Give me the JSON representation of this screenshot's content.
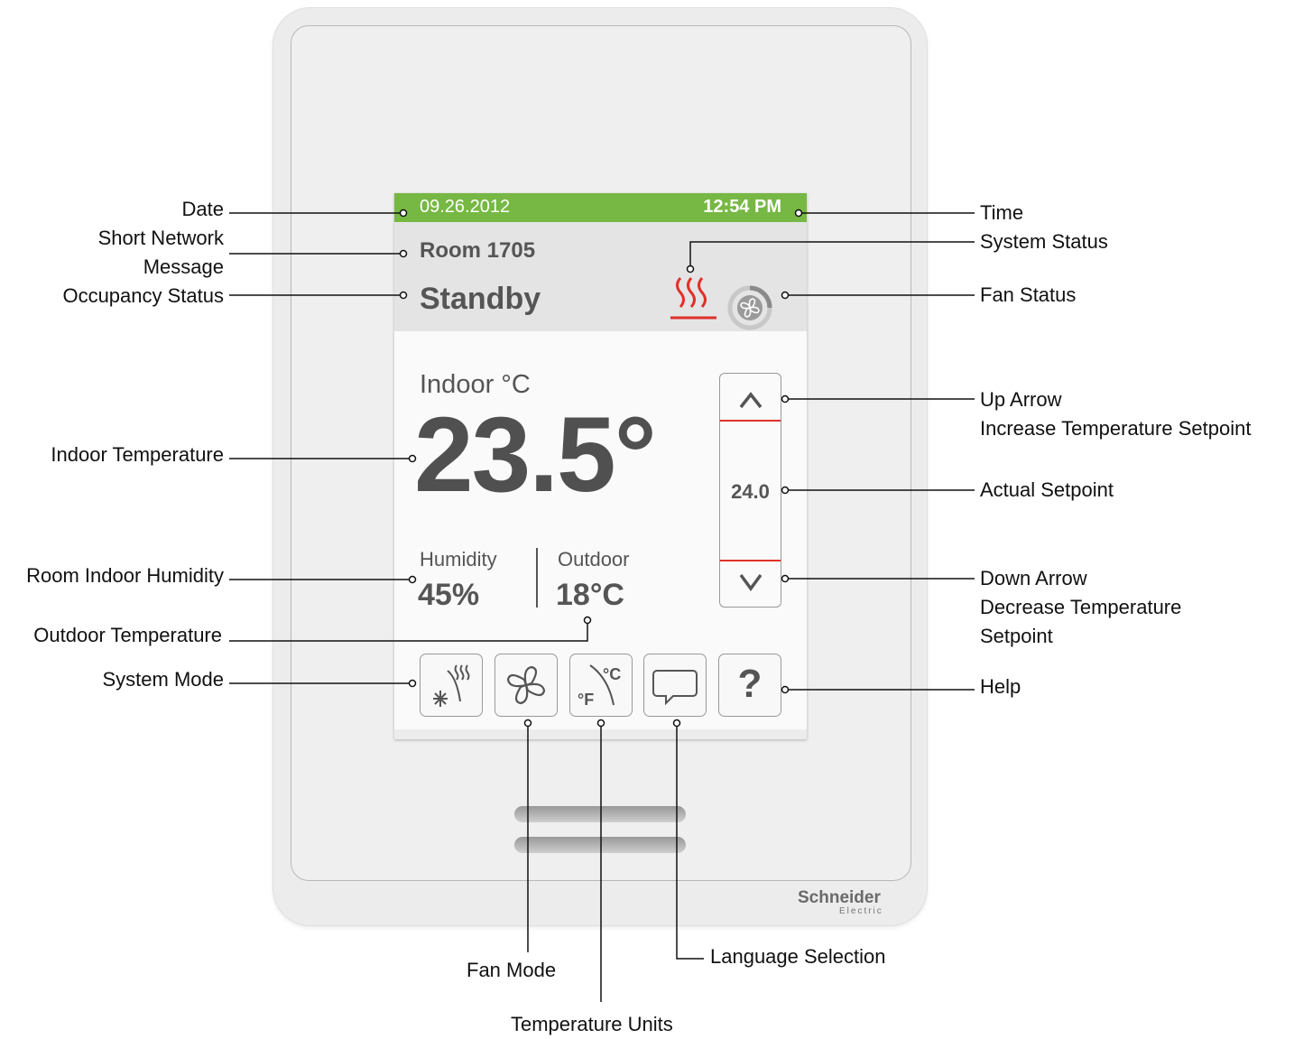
{
  "screen": {
    "date": "09.26.2012",
    "time": "12:54 PM",
    "room": "Room 1705",
    "occupancy": "Standby",
    "indoor_label": "Indoor °C",
    "indoor_temp": "23.5°",
    "humidity_label": "Humidity",
    "humidity_value": "45%",
    "outdoor_label": "Outdoor",
    "outdoor_value": "18°C",
    "setpoint": "24.0",
    "up_arrow": "^",
    "down_arrow": "V",
    "help_glyph": "?",
    "units_c": "°C",
    "units_f": "°F"
  },
  "device": {
    "brand": "Schneider",
    "brand_sub": "Electric"
  },
  "callouts": {
    "date": "Date",
    "short_network_message_line1": "Short Network",
    "short_network_message_line2": "Message",
    "occupancy_status": "Occupancy Status",
    "indoor_temperature": "Indoor Temperature",
    "room_indoor_humidity": "Room Indoor Humidity",
    "outdoor_temperature": "Outdoor Temperature",
    "system_mode": "System Mode",
    "time": "Time",
    "system_status": "System Status",
    "fan_status": "Fan Status",
    "up_arrow_line1": "Up Arrow",
    "up_arrow_line2": "Increase Temperature Setpoint",
    "actual_setpoint": "Actual Setpoint",
    "down_arrow_line1": "Down Arrow",
    "down_arrow_line2": "Decrease Temperature",
    "down_arrow_line3": "Setpoint",
    "help": "Help",
    "fan_mode": "Fan Mode",
    "temperature_units": "Temperature Units",
    "language_selection": "Language Selection"
  },
  "colors": {
    "top_bar": "#76b843",
    "heat_icon": "#e0302a",
    "text_gray": "#555555"
  }
}
